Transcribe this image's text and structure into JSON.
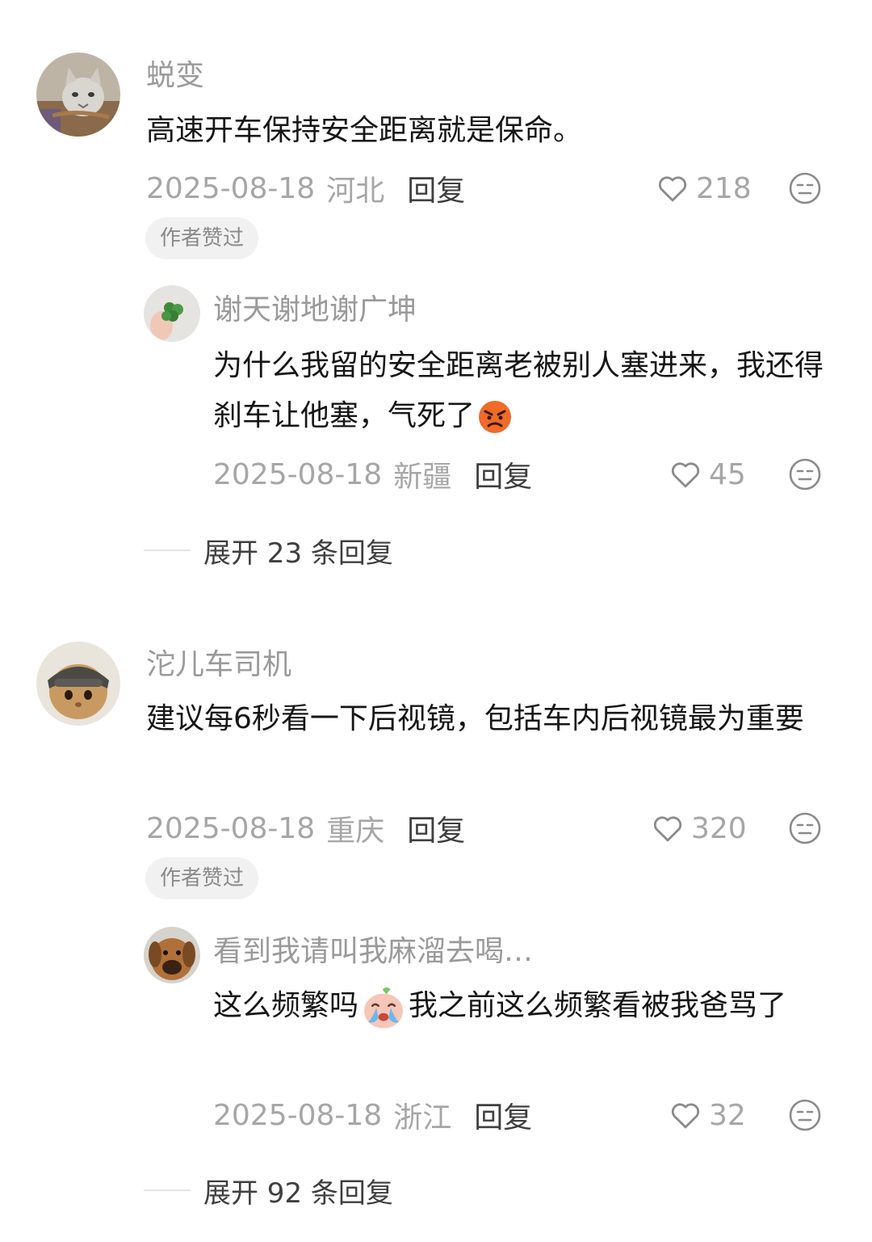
{
  "threads": [
    {
      "comment": {
        "username": "蜕变",
        "text": "高速开车保持安全距离就是保命。",
        "date": "2025-08-18",
        "region": "河北",
        "reply_label": "回复",
        "likes": "218",
        "badge": "作者赞过",
        "avatar_icon": "cat-avatar-icon"
      },
      "reply": {
        "username": "谢天谢地谢广坤",
        "text_before": "为什么我留的安全距离老被别人塞进来，我还得刹车让他塞，气死了",
        "emoji": "angry-face-emoji",
        "text_after": "",
        "date": "2025-08-18",
        "region": "新疆",
        "reply_label": "回复",
        "likes": "45",
        "avatar_icon": "clover-hand-avatar-icon"
      },
      "expand_label": "展开 23 条回复"
    },
    {
      "comment": {
        "username": "沱儿车司机",
        "text": "建议每6秒看一下后视镜，包括车内后视镜最为重要",
        "date": "2025-08-18",
        "region": "重庆",
        "reply_label": "回复",
        "likes": "320",
        "badge": "作者赞过",
        "avatar_icon": "helmet-cat-avatar-icon"
      },
      "reply": {
        "username": "看到我请叫我麻溜去喝…",
        "text_before": "这么频繁吗",
        "emoji": "crying-face-emoji",
        "text_after": "我之前这么频繁看被我爸骂了",
        "date": "2025-08-18",
        "region": "浙江",
        "reply_label": "回复",
        "likes": "32",
        "avatar_icon": "dog-avatar-icon"
      },
      "expand_label": "展开 92 条回复"
    }
  ],
  "colors": {
    "username": "#9a9a9a",
    "text": "#161616",
    "meta": "#a6a6a6",
    "reply": "#3f3f3f",
    "badge_bg": "#f1f1f1"
  }
}
